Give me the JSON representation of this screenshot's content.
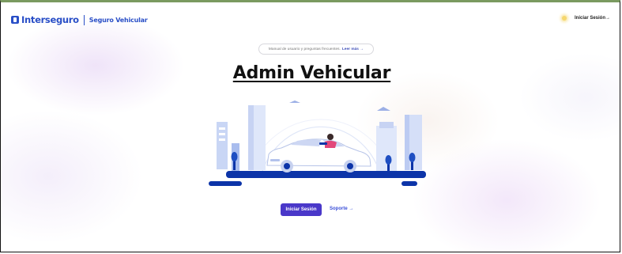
{
  "header": {
    "brand": "Interseguro",
    "product": "Seguro Vehicular",
    "login_link": "Iniciar Sesión→"
  },
  "hero": {
    "manual_text": "Manual de usuario y preguntas frecuentes.",
    "manual_link": "Leer más →",
    "title": "Admin Vehicular"
  },
  "actions": {
    "login_button": "Iniciar Sesión",
    "support_link": "Soporte →"
  },
  "icons": {
    "logo": "interseguro-logo-icon",
    "theme": "sun-icon",
    "illustration": "car-city-illustration"
  },
  "colors": {
    "brand": "#2a4fc7",
    "primary_button": "#4a38c9",
    "link": "#3b4fd8",
    "illustration_dark": "#0c34a8"
  }
}
